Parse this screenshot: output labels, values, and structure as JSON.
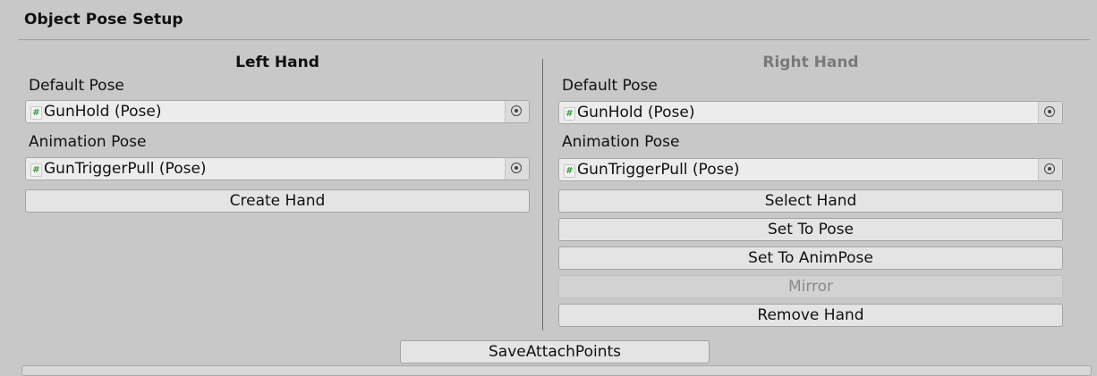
{
  "header": {
    "title": "Object Pose Setup"
  },
  "left": {
    "title": "Left Hand",
    "default_label": "Default Pose",
    "default_value": "GunHold (Pose)",
    "anim_label": "Animation Pose",
    "anim_value": "GunTriggerPull (Pose)",
    "create_label": "Create Hand"
  },
  "right": {
    "title": "Right Hand",
    "default_label": "Default Pose",
    "default_value": "GunHold (Pose)",
    "anim_label": "Animation Pose",
    "anim_value": "GunTriggerPull (Pose)",
    "select_label": "Select Hand",
    "set_pose_label": "Set To Pose",
    "set_anim_label": "Set To AnimPose",
    "mirror_label": "Mirror",
    "remove_label": "Remove Hand"
  },
  "footer": {
    "save_label": "SaveAttachPoints"
  },
  "icons": {
    "script": "hash-icon",
    "picker": "object-picker-icon"
  }
}
